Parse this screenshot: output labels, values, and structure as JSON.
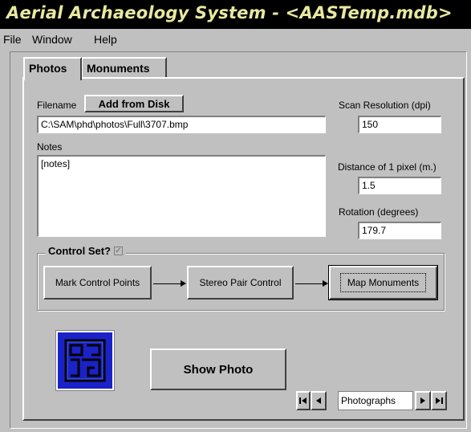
{
  "window": {
    "title": "Aerial Archaeology System - <AASTemp.mdb>"
  },
  "menu": {
    "items": [
      "File",
      "Window",
      "Help"
    ]
  },
  "tabs": [
    {
      "label": "Photos",
      "active": true
    },
    {
      "label": "Monuments",
      "active": false
    }
  ],
  "photo_form": {
    "filename_label": "Filename",
    "add_from_disk_label": "Add from Disk",
    "filename_value": "C:\\SAM\\phd\\photos\\Full\\3707.bmp",
    "notes_label": "Notes",
    "notes_value": "[notes]",
    "scan_resolution_label": "Scan Resolution (dpi)",
    "scan_resolution_value": "150",
    "pixel_distance_label": "Distance of 1 pixel (m.)",
    "pixel_distance_value": "1.5",
    "rotation_label": "Rotation (degrees)",
    "rotation_value": "179.7"
  },
  "control_set": {
    "label": "Control Set?",
    "checked": true,
    "mark_control_points_label": "Mark Control Points",
    "stereo_pair_control_label": "Stereo Pair Control",
    "map_monuments_label": "Map Monuments"
  },
  "show_photo_label": "Show Photo",
  "record_nav": {
    "first_icon": "first-record-icon",
    "prev_icon": "previous-record-icon",
    "current_label": "Photographs",
    "next_icon": "next-record-icon",
    "last_icon": "last-record-icon"
  },
  "colors": {
    "title_text": "#e8e8a0",
    "title_bar": "#000000",
    "window_bg": "#c0c0c0",
    "logo_bg": "#1a22c8"
  }
}
